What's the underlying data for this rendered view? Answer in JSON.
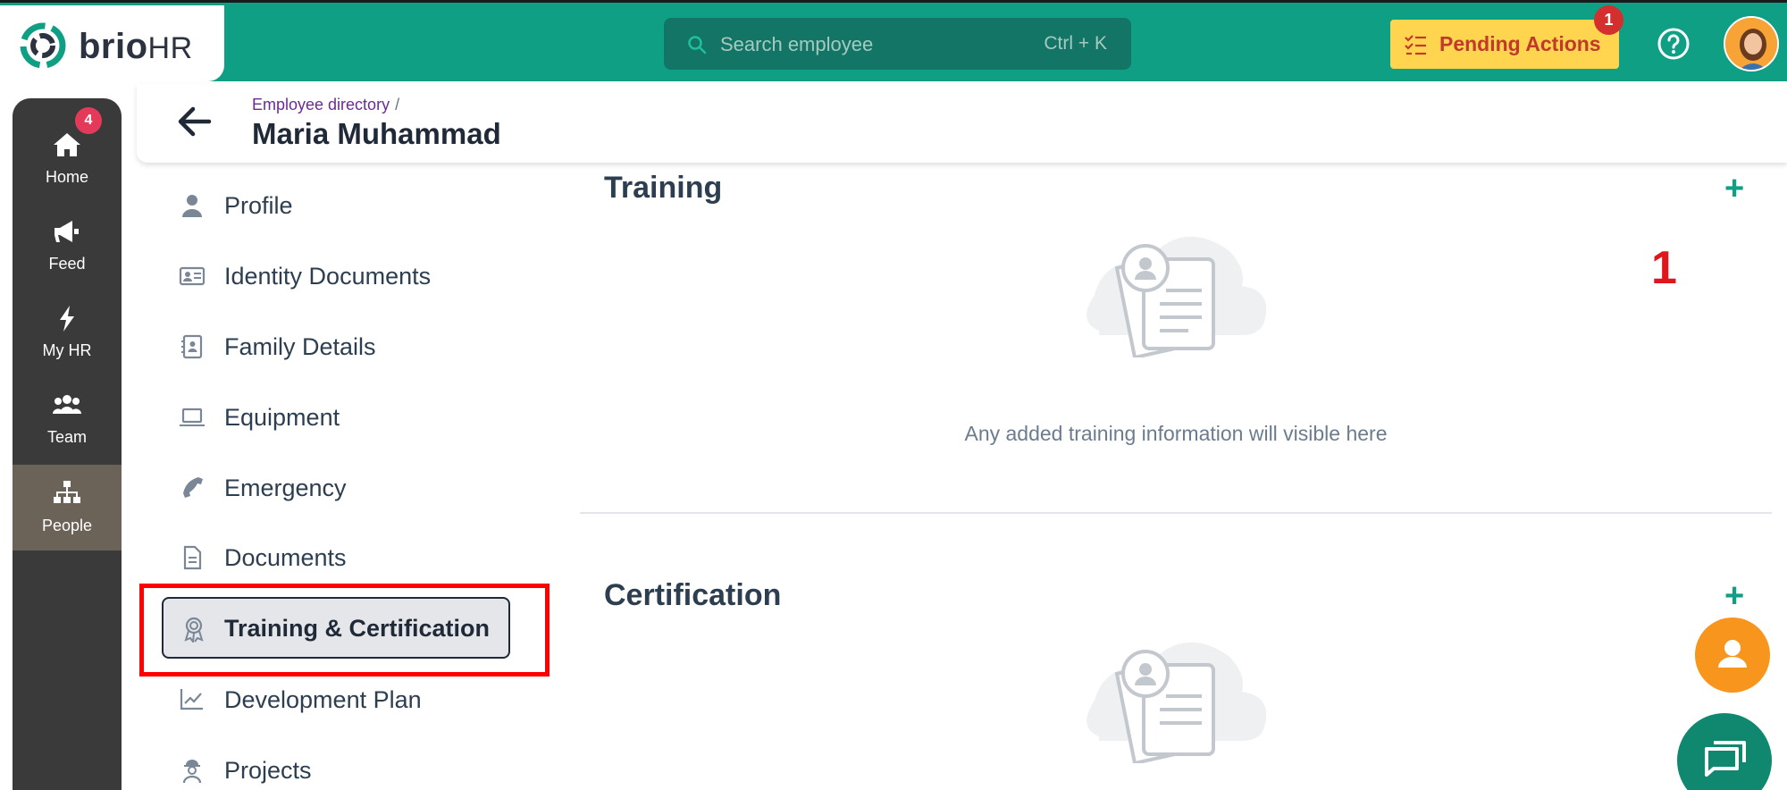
{
  "brand": {
    "name_main": "brio",
    "name_suffix": "HR"
  },
  "search": {
    "placeholder": "Search employee",
    "shortcut": "Ctrl + K"
  },
  "pending": {
    "label": "Pending Actions",
    "count": "1"
  },
  "sidenav": {
    "items": [
      {
        "label": "Home",
        "icon": "home-icon"
      },
      {
        "label": "Feed",
        "icon": "megaphone-icon",
        "badge": "4"
      },
      {
        "label": "My HR",
        "icon": "bolt-icon"
      },
      {
        "label": "Team",
        "icon": "team-icon"
      },
      {
        "label": "People",
        "icon": "org-chart-icon",
        "active": true
      }
    ]
  },
  "header": {
    "breadcrumb": "Employee directory",
    "breadcrumb_sep": "/",
    "title": "Maria Muhammad"
  },
  "menu": {
    "items": [
      {
        "label": "Profile",
        "icon": "person-icon"
      },
      {
        "label": "Identity Documents",
        "icon": "id-card-icon"
      },
      {
        "label": "Family Details",
        "icon": "contact-book-icon"
      },
      {
        "label": "Equipment",
        "icon": "laptop-icon"
      },
      {
        "label": "Emergency",
        "icon": "phone-icon"
      },
      {
        "label": "Documents",
        "icon": "document-icon"
      },
      {
        "label": "Training & Certification",
        "icon": "award-icon",
        "active": true
      },
      {
        "label": "Development Plan",
        "icon": "chart-line-icon"
      },
      {
        "label": "Projects",
        "icon": "worker-icon"
      }
    ]
  },
  "training": {
    "title": "Training",
    "empty_text": "Any added training information will visible here"
  },
  "certification": {
    "title": "Certification"
  },
  "annotation": {
    "number": "1"
  },
  "colors": {
    "topbar": "#0e9f85",
    "accent": "#0e9f85",
    "pending_bg": "#ffd54f",
    "highlight": "#ff0000"
  }
}
